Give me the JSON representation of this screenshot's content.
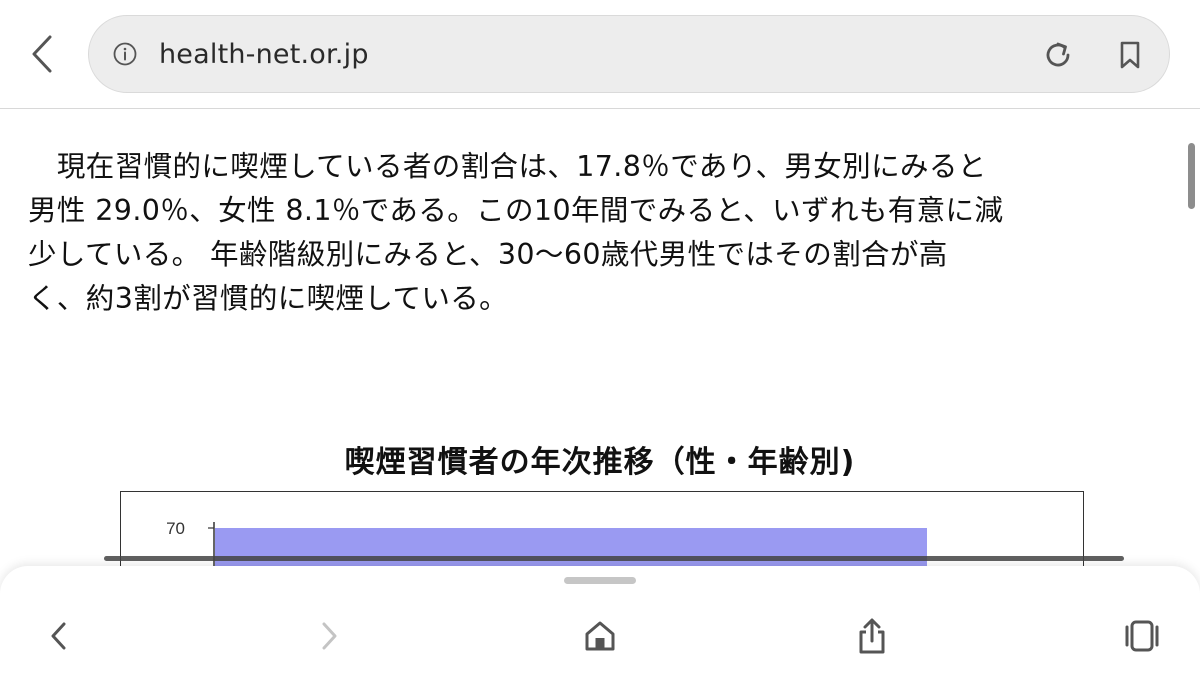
{
  "address_bar": {
    "url": "health-net.or.jp"
  },
  "article": {
    "paragraph": "　現在習慣的に喫煙している者の割合は、17.8％であり、男女別にみると\n男性 29.0％、女性 8.1％である。この10年間でみると、いずれも有意に減\n少している。 年齢階級別にみると、30～60歳代男性ではその割合が高\nく、約3割が習慣的に喫煙している。"
  },
  "chart": {
    "title": "喫煙習慣者の年次推移（性・年齢別)",
    "ytick_top": "70"
  },
  "chart_data": {
    "type": "bar",
    "title": "喫煙習慣者の年次推移（性・年齢別)",
    "yticks": [
      70
    ],
    "series": [
      {
        "values": [
          70
        ]
      }
    ],
    "bar_color": "#9a9af2"
  },
  "colors": {
    "icon": "#555555",
    "icon_disabled": "#c4c4c4",
    "bar": "#9a9af2"
  },
  "icons": {
    "top_back": "chevron-left-icon",
    "info": "info-icon",
    "reload": "reload-icon",
    "bookmark": "bookmark-icon",
    "bottom_back": "chevron-left-icon",
    "bottom_forward": "chevron-right-icon",
    "home": "home-icon",
    "share": "share-icon",
    "tabs": "tabs-icon"
  }
}
